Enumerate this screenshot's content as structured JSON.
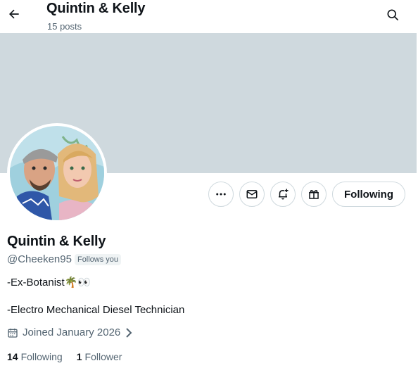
{
  "header": {
    "title": "Quintin & Kelly",
    "posts": "15 posts"
  },
  "colors": {
    "banner": "#cfd9de",
    "text": "#0f1419",
    "muted": "#536471",
    "border": "#cfd9de"
  },
  "actions": {
    "more_icon": "more-horizontal-icon",
    "message_icon": "envelope-icon",
    "notify_icon": "bell-plus-icon",
    "subscribe_icon": "gift-icon",
    "following_label": "Following"
  },
  "profile": {
    "name": "Quintin & Kelly",
    "handle": "@Cheeken95",
    "follows_you": "Follows you",
    "bio_line1": "-Ex-Botanist",
    "bio_line1_emoji": "🌴👀",
    "bio_line2": "-Electro Mechanical Diesel Technician",
    "joined": "Joined January 2026"
  },
  "stats": {
    "following_count": "14",
    "following_label": "Following",
    "followers_count": "1",
    "followers_label": "Follower"
  }
}
